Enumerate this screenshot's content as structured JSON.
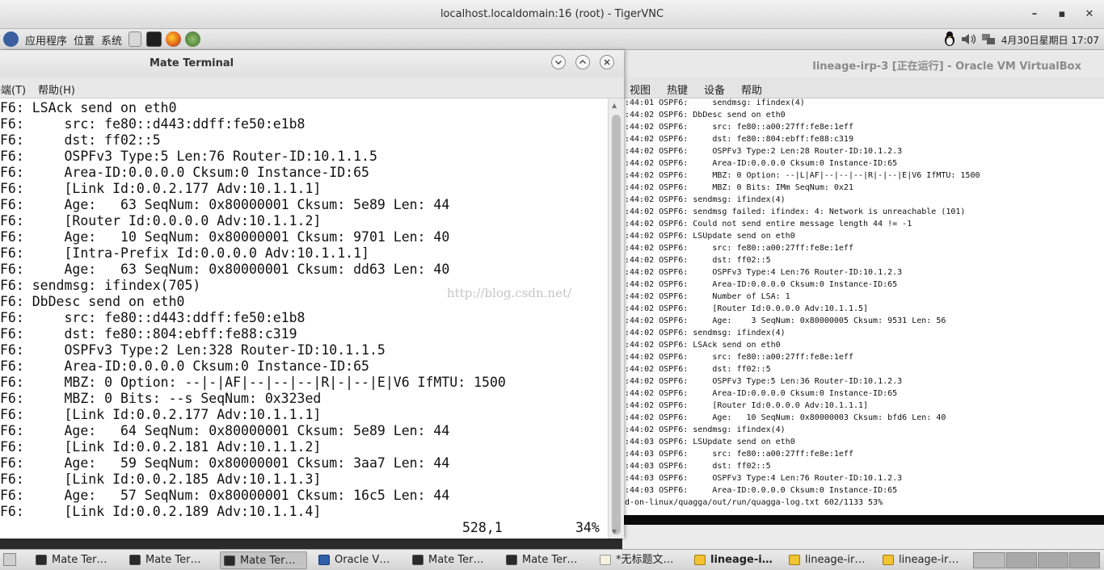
{
  "vnc": {
    "title": "localhost.localdomain:16 (root) - TigerVNC",
    "minimize": "–",
    "maximize": "▪",
    "close": "✕"
  },
  "top_panel": {
    "applications": "应用程序",
    "places": "位置",
    "system": "系统",
    "clock": "4月30日星期日 17:07"
  },
  "terminal": {
    "title": "Mate Terminal",
    "menu": [
      "终端(T)",
      "帮助(H)"
    ],
    "lines": [
      "F6: LSAck send on eth0",
      "F6:     src: fe80::d443:ddff:fe50:e1b8",
      "F6:     dst: ff02::5",
      "F6:     OSPFv3 Type:5 Len:76 Router-ID:10.1.1.5",
      "F6:     Area-ID:0.0.0.0 Cksum:0 Instance-ID:65",
      "F6:     [Link Id:0.0.2.177 Adv:10.1.1.1]",
      "F6:     Age:   63 SeqNum: 0x80000001 Cksum: 5e89 Len: 44",
      "F6:     [Router Id:0.0.0.0 Adv:10.1.1.2]",
      "F6:     Age:   10 SeqNum: 0x80000001 Cksum: 9701 Len: 40",
      "F6:     [Intra-Prefix Id:0.0.0.0 Adv:10.1.1.1]",
      "F6:     Age:   63 SeqNum: 0x80000001 Cksum: dd63 Len: 40",
      "F6: sendmsg: ifindex(705)",
      "F6: DbDesc send on eth0",
      "F6:     src: fe80::d443:ddff:fe50:e1b8",
      "F6:     dst: fe80::804:ebff:fe88:c319",
      "F6:     OSPFv3 Type:2 Len:328 Router-ID:10.1.1.5",
      "F6:     Area-ID:0.0.0.0 Cksum:0 Instance-ID:65",
      "F6:     MBZ: 0 Option: --|-|AF|--|--|--|R|-|--|E|V6 IfMTU: 1500",
      "F6:     MBZ: 0 Bits: --s SeqNum: 0x323ed",
      "F6:     [Link Id:0.0.2.177 Adv:10.1.1.1]",
      "F6:     Age:   64 SeqNum: 0x80000001 Cksum: 5e89 Len: 44",
      "F6:     [Link Id:0.0.2.181 Adv:10.1.1.2]",
      "F6:     Age:   59 SeqNum: 0x80000001 Cksum: 3aa7 Len: 44",
      "F6:     [Link Id:0.0.2.185 Adv:10.1.1.3]",
      "F6:     Age:   57 SeqNum: 0x80000001 Cksum: 16c5 Len: 44",
      "F6:     [Link Id:0.0.2.189 Adv:10.1.1.4]"
    ],
    "cursor_pos": "528,1",
    "scroll_percent": "34%"
  },
  "watermark": "http://blog.csdn.net/",
  "vbox": {
    "title": "lineage-irp-3 [正在运行] - Oracle VM VirtualBox",
    "menu": [
      "视图",
      "热键",
      "设备",
      "帮助"
    ],
    "log_lines": [
      ":44:01 OSPF6:     sendmsg: ifindex(4)",
      ":44:02 OSPF6: DbDesc send on eth0",
      ":44:02 OSPF6:     src: fe80::a00:27ff:fe8e:1eff",
      ":44:02 OSPF6:     dst: fe80::804:ebff:fe88:c319",
      ":44:02 OSPF6:     OSPFv3 Type:2 Len:28 Router-ID:10.1.2.3",
      ":44:02 OSPF6:     Area-ID:0.0.0.0 Cksum:0 Instance-ID:65",
      ":44:02 OSPF6:     MBZ: 0 Option: --|L|AF|--|--|--|R|-|--|E|V6 IfMTU: 1500",
      ":44:02 OSPF6:     MBZ: 0 Bits: IMm SeqNum: 0x21",
      ":44:02 OSPF6: sendmsg: ifindex(4)",
      ":44:02 OSPF6: sendmsg failed: ifindex: 4: Network is unreachable (101)",
      ":44:02 OSPF6: Could not send entire message length 44 != -1",
      ":44:02 OSPF6: LSUpdate send on eth0",
      ":44:02 OSPF6:     src: fe80::a00:27ff:fe8e:1eff",
      ":44:02 OSPF6:     dst: ff02::5",
      ":44:02 OSPF6:     OSPFv3 Type:4 Len:76 Router-ID:10.1.2.3",
      ":44:02 OSPF6:     Area-ID:0.0.0.0 Cksum:0 Instance-ID:65",
      ":44:02 OSPF6:     Number of LSA: 1",
      ":44:02 OSPF6:     [Router Id:0.0.0.0 Adv:10.1.1.5]",
      ":44:02 OSPF6:     Age:    3 SeqNum: 0x80000005 Cksum: 9531 Len: 56",
      ":44:02 OSPF6: sendmsg: ifindex(4)",
      ":44:02 OSPF6: LSAck send on eth0",
      ":44:02 OSPF6:     src: fe80::a00:27ff:fe8e:1eff",
      ":44:02 OSPF6:     dst: ff02::5",
      ":44:02 OSPF6:     OSPFv3 Type:5 Len:36 Router-ID:10.1.2.3",
      ":44:02 OSPF6:     Area-ID:0.0.0.0 Cksum:0 Instance-ID:65",
      ":44:02 OSPF6:     [Router Id:0.0.0.0 Adv:10.1.1.1]",
      ":44:02 OSPF6:     Age:   10 SeqNum: 0x80000003 Cksum: bfd6 Len: 40",
      ":44:02 OSPF6: sendmsg: ifindex(4)",
      ":44:03 OSPF6: LSUpdate send on eth0",
      ":44:03 OSPF6:     src: fe80::a00:27ff:fe8e:1eff",
      ":44:03 OSPF6:     dst: ff02::5",
      ":44:03 OSPF6:     OSPFv3 Type:4 Len:76 Router-ID:10.1.2.3",
      ":44:03 OSPF6:     Area-ID:0.0.0.0 Cksum:0 Instance-ID:65",
      "d-on-linux/quagga/out/run/quagga-log.txt 602/1133 53%"
    ]
  },
  "taskbar": {
    "tasks": [
      "Mate Ter…",
      "Mate Ter…",
      "Mate Ter…",
      "Oracle V…",
      "Mate Ter…",
      "Mate Ter…",
      "*无标题文…",
      "lineage-i…",
      "lineage-ir…",
      "lineage-ir…"
    ]
  }
}
